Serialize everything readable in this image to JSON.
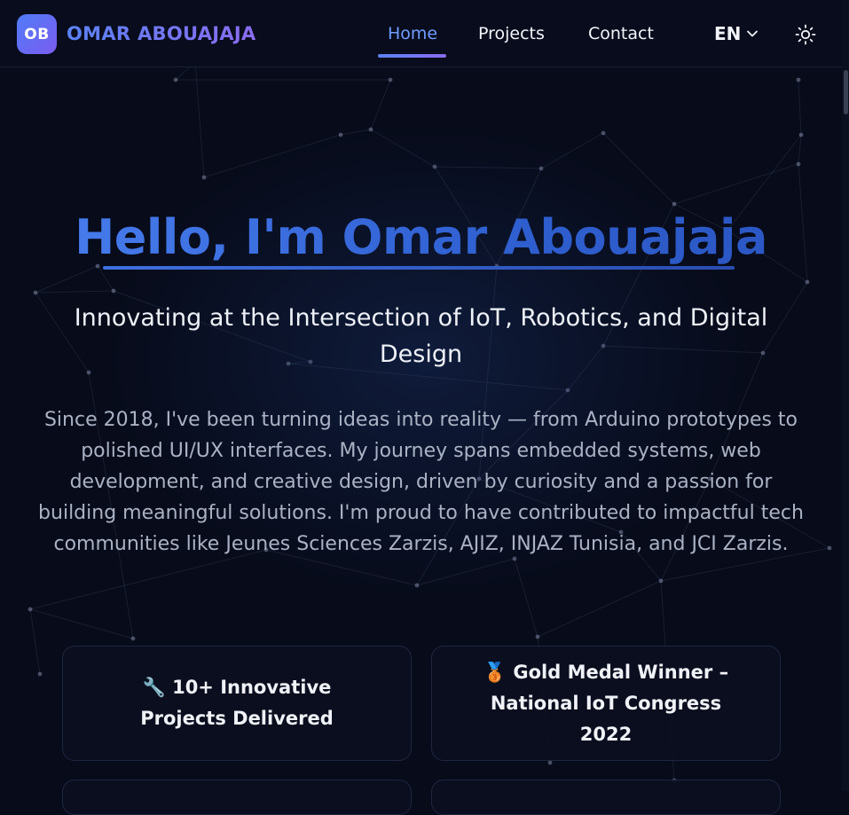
{
  "brand": {
    "initials": "OB",
    "name": "OMAR ABOUAJAJA"
  },
  "nav": {
    "links": [
      "Home",
      "Projects",
      "Contact"
    ],
    "active": "Home",
    "language": "EN"
  },
  "hero": {
    "title": "Hello, I'm Omar Abouajaja",
    "subtitle": "Innovating at the Intersection of IoT, Robotics, and Digital Design",
    "description": "Since 2018, I've been turning ideas into reality — from Arduino prototypes to polished UI/UX interfaces. My journey spans embedded systems, web development, and creative design, driven by curiosity and a passion for building meaningful solutions. I'm proud to have contributed to impactful tech communities like Jeunes Sciences Zarzis, AJIZ, INJAZ Tunisia, and JCI Zarzis."
  },
  "highlights": [
    {
      "emoji": "🔧",
      "text": "10+ Innovative Projects Delivered"
    },
    {
      "emoji": "🥉",
      "text": "Gold Medal Winner – National IoT Congress 2022"
    }
  ],
  "colors": {
    "background": "#070b1a",
    "accent": "#5b82f5",
    "accent_secondary": "#8a6cf0",
    "title": "#3f6fe0",
    "body_text": "#aab2c4"
  },
  "icons": {
    "language_toggle": "chevron-down-icon",
    "theme_toggle": "sun-icon"
  }
}
